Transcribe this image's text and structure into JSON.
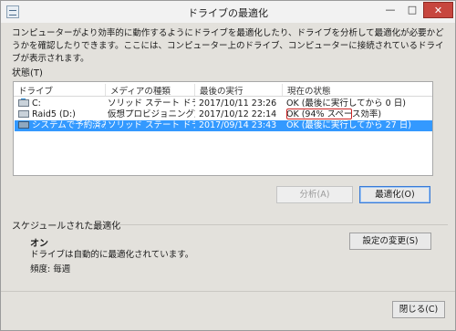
{
  "window": {
    "title": "ドライブの最適化",
    "controls": {
      "minimize": "—",
      "maximize": "□",
      "close": "✕"
    }
  },
  "description": "コンピューターがより効率的に動作するようにドライブを最適化したり、ドライブを分析して最適化が必要かどうかを確認したりできます。ここには、コンピューター上のドライブ、コンピューターに接続されているドライブが表示されます。",
  "status": {
    "label": "状態(T)",
    "columns": [
      "ドライブ",
      "メディアの種類",
      "最後の実行",
      "現在の状態"
    ],
    "rows": [
      {
        "drive": "C:",
        "media": "ソリッド ステート ドライブ",
        "last_run": "2017/10/11 23:26",
        "state": "OK (最後に実行してから 0 日)",
        "icon": "windows-drive-icon",
        "selected": false
      },
      {
        "drive": "Raid5 (D:)",
        "media": "仮想プロビジョニング対応...",
        "last_run": "2017/10/12 22:14",
        "state": "OK (94% スペース効率)",
        "icon": "drive-icon",
        "selected": false
      },
      {
        "drive": "システムで予約済み",
        "media": "ソリッド ステート ドライブ",
        "last_run": "2017/09/14 23:43",
        "state": "OK (最後に実行してから 27 日)",
        "icon": "system-drive-icon",
        "selected": true
      }
    ]
  },
  "buttons": {
    "analyze": "分析(A)",
    "optimize": "最適化(O)"
  },
  "schedule": {
    "title": "スケジュールされた最適化",
    "state": "オン",
    "description": "ドライブは自動的に最適化されています。",
    "frequency": "頻度: 毎週",
    "change_settings": "設定の変更(S)"
  },
  "footer": {
    "close": "閉じる(C)"
  },
  "colors": {
    "selection": "#3399ff",
    "highlight_box": "#cc2222",
    "close_button": "#c7463e"
  }
}
